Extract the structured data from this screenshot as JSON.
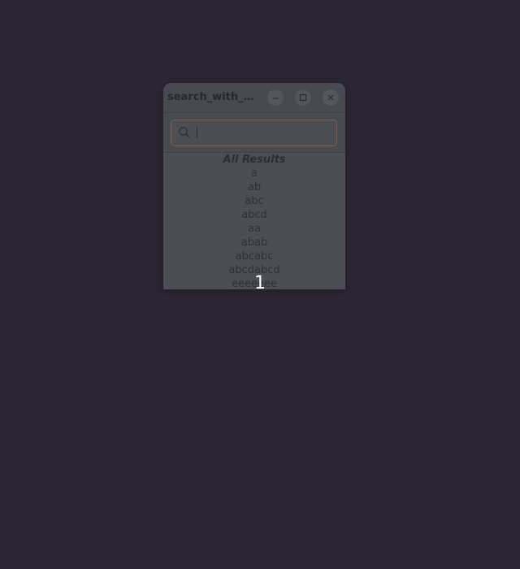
{
  "window": {
    "title": "search_with_m...",
    "minimize_icon": "minimize-icon",
    "maximize_icon": "maximize-icon",
    "close_icon": "close-icon"
  },
  "search": {
    "value": "",
    "placeholder": "",
    "icon": "search-icon"
  },
  "results": {
    "header": "All Results",
    "items": [
      "a",
      "ab",
      "abc",
      "abcd",
      "aa",
      "abab",
      "abcabc",
      "abcdabcd",
      "eeeeeee"
    ]
  },
  "overlay": {
    "number": "1"
  },
  "colors": {
    "desktop": "#2c2632",
    "window": "#4b4f55",
    "search_border": "#8a5a4a"
  }
}
